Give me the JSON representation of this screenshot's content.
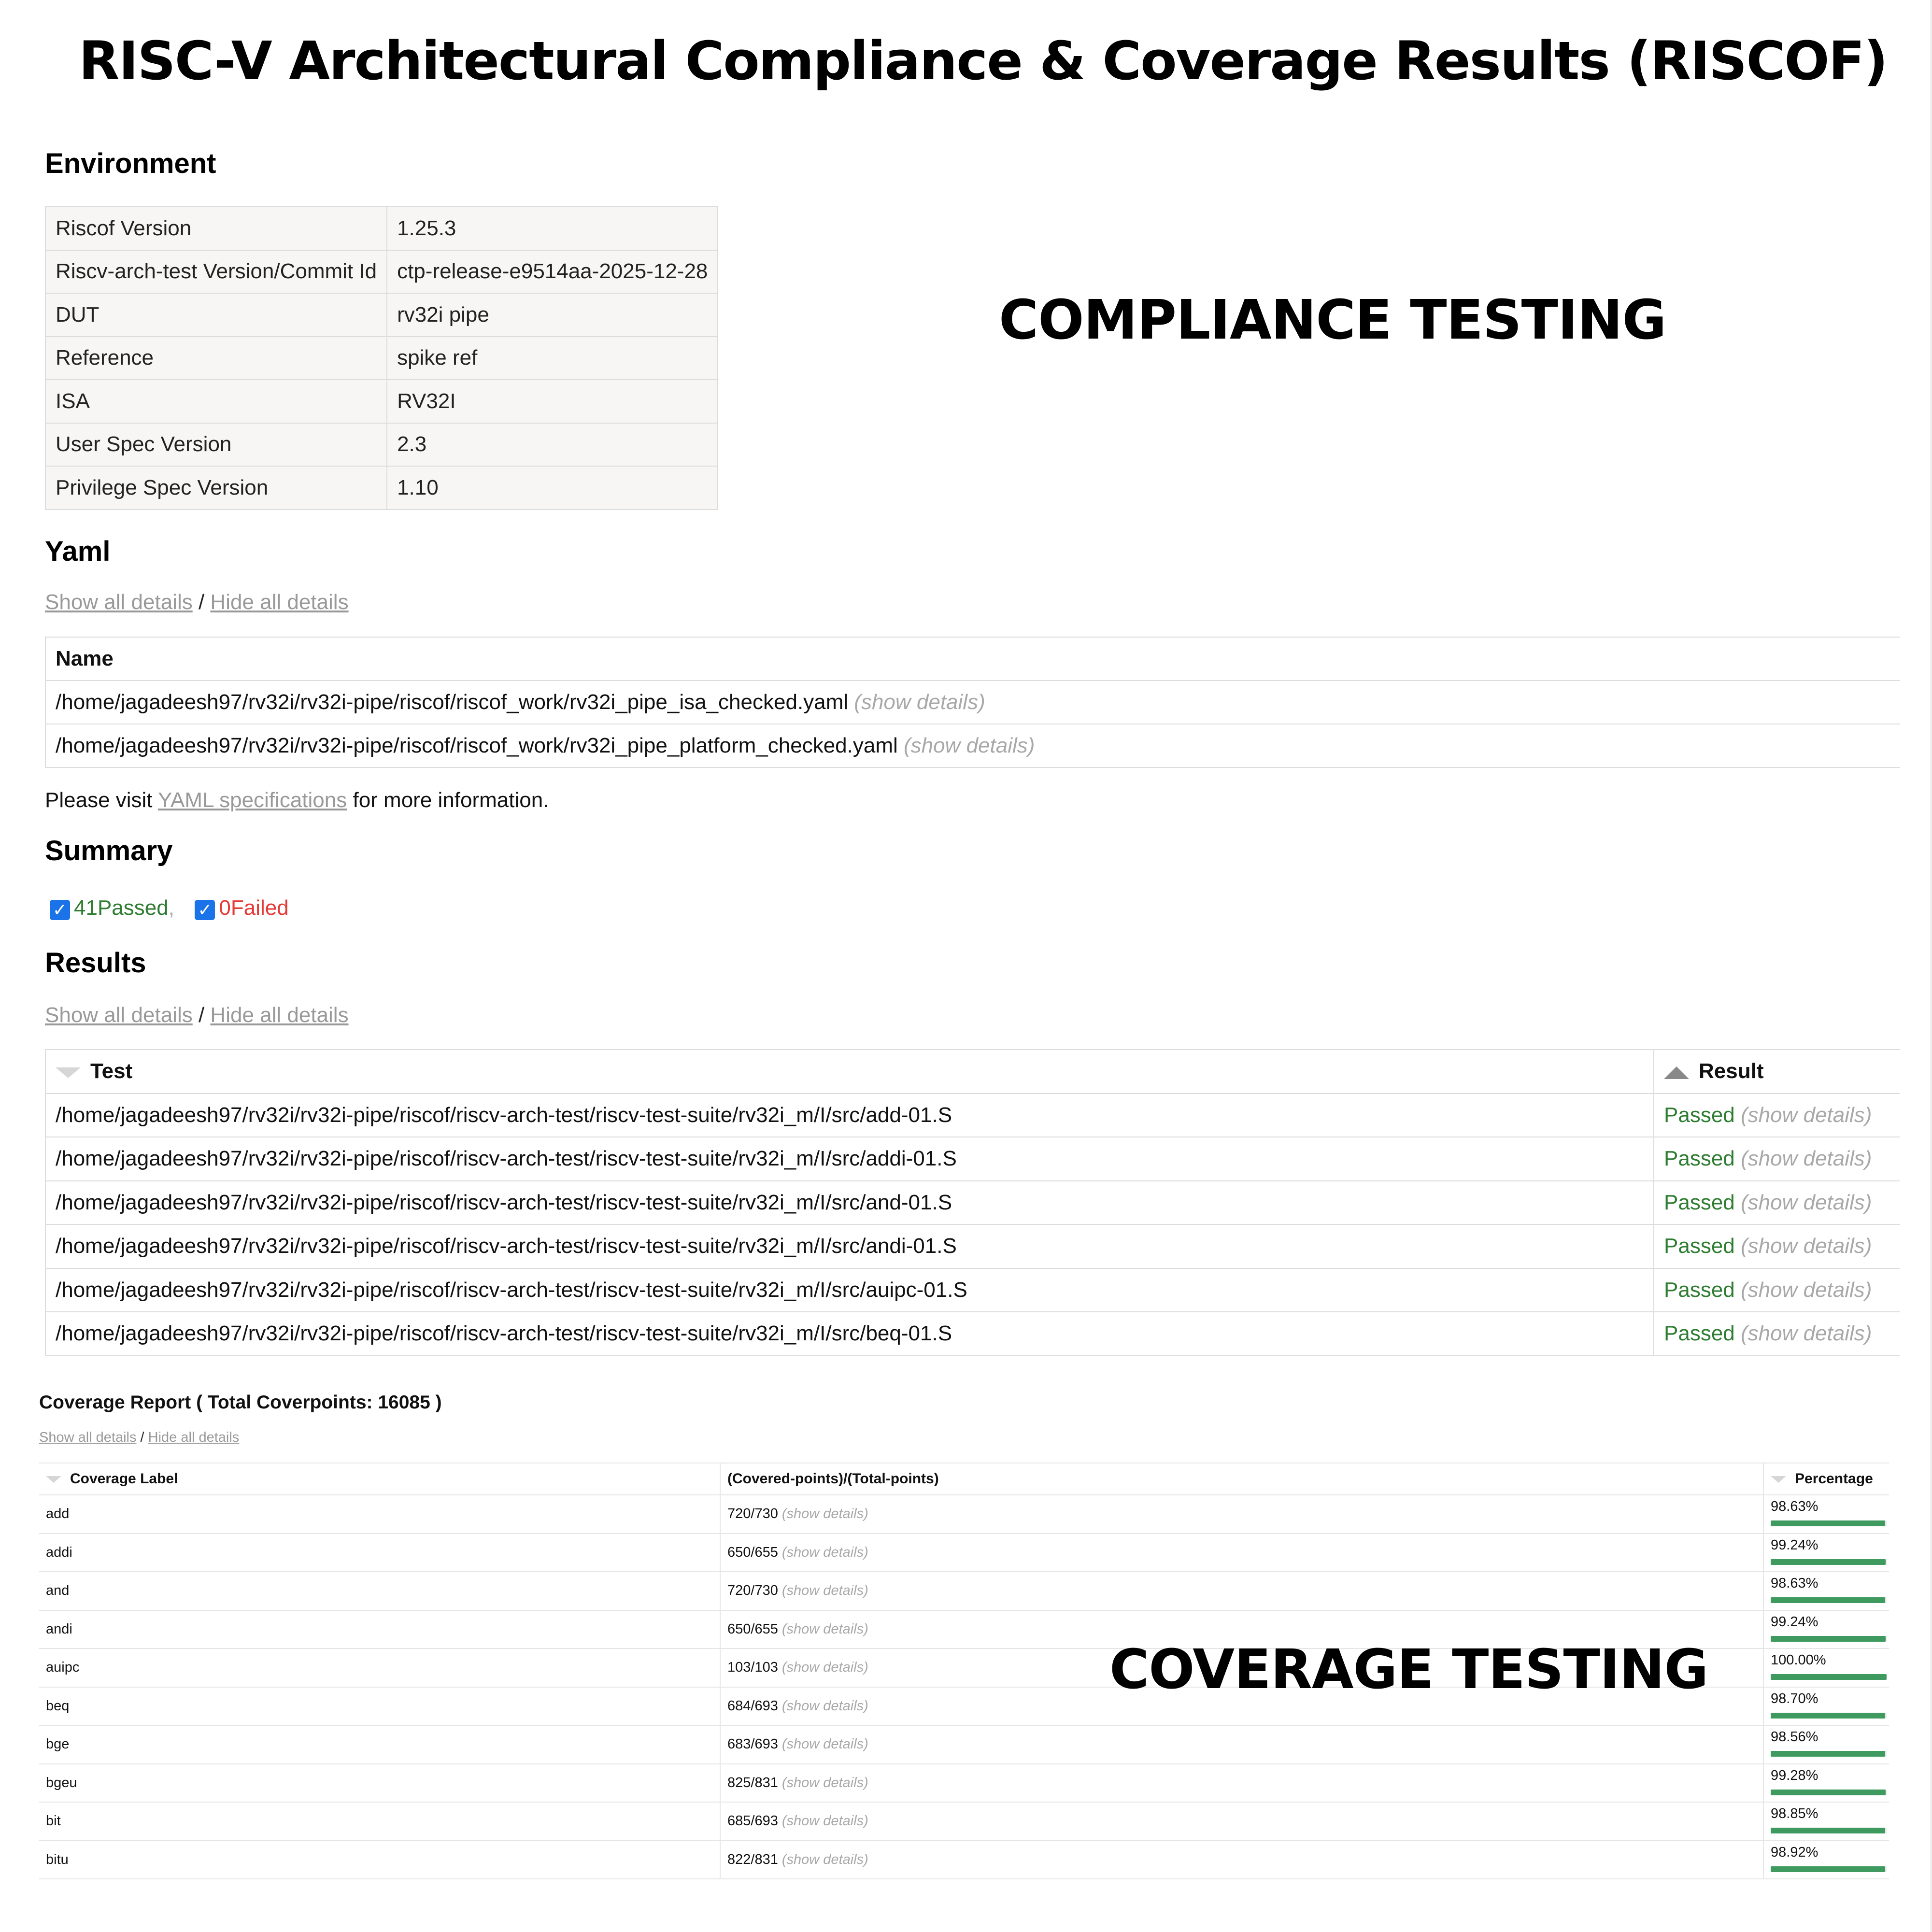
{
  "page_title": "RISC-V Architectural Compliance & Coverage Results (RISCOF)",
  "overlay_compliance": "COMPLIANCE TESTING",
  "overlay_coverage": "COVERAGE TESTING",
  "environment": {
    "heading": "Environment",
    "rows": [
      {
        "key": "Riscof Version",
        "value": "1.25.3"
      },
      {
        "key": "Riscv-arch-test Version/Commit Id",
        "value": "ctp-release-e9514aa-2025-12-28"
      },
      {
        "key": "DUT",
        "value": "rv32i pipe"
      },
      {
        "key": "Reference",
        "value": "spike ref"
      },
      {
        "key": "ISA",
        "value": "RV32I"
      },
      {
        "key": "User Spec Version",
        "value": "2.3"
      },
      {
        "key": "Privilege Spec Version",
        "value": "1.10"
      }
    ]
  },
  "links": {
    "show_all": "Show all details",
    "sep": " / ",
    "hide_all": "Hide all details",
    "show_details": "(show details)"
  },
  "yaml": {
    "heading": "Yaml",
    "column": "Name",
    "rows": [
      "/home/jagadeesh97/rv32i/rv32i-pipe/riscof/riscof_work/rv32i_pipe_isa_checked.yaml",
      "/home/jagadeesh97/rv32i/rv32i-pipe/riscof/riscof_work/rv32i_pipe_platform_checked.yaml"
    ],
    "note_prefix": "Please visit ",
    "note_link": "YAML specifications",
    "note_suffix": " for more information."
  },
  "summary": {
    "heading": "Summary",
    "passed": "41Passed",
    "comma": ",",
    "failed": "0Failed"
  },
  "results": {
    "heading": "Results",
    "col_test": "Test",
    "col_result": "Result",
    "rows": [
      {
        "test": "/home/jagadeesh97/rv32i/rv32i-pipe/riscof/riscv-arch-test/riscv-test-suite/rv32i_m/I/src/add-01.S",
        "result": "Passed"
      },
      {
        "test": "/home/jagadeesh97/rv32i/rv32i-pipe/riscof/riscv-arch-test/riscv-test-suite/rv32i_m/I/src/addi-01.S",
        "result": "Passed"
      },
      {
        "test": "/home/jagadeesh97/rv32i/rv32i-pipe/riscof/riscv-arch-test/riscv-test-suite/rv32i_m/I/src/and-01.S",
        "result": "Passed"
      },
      {
        "test": "/home/jagadeesh97/rv32i/rv32i-pipe/riscof/riscv-arch-test/riscv-test-suite/rv32i_m/I/src/andi-01.S",
        "result": "Passed"
      },
      {
        "test": "/home/jagadeesh97/rv32i/rv32i-pipe/riscof/riscv-arch-test/riscv-test-suite/rv32i_m/I/src/auipc-01.S",
        "result": "Passed"
      },
      {
        "test": "/home/jagadeesh97/rv32i/rv32i-pipe/riscof/riscv-arch-test/riscv-test-suite/rv32i_m/I/src/beq-01.S",
        "result": "Passed"
      }
    ]
  },
  "coverage": {
    "title": "Coverage Report ( Total Coverpoints: 16085 )",
    "col_label": "Coverage Label",
    "col_points": "(Covered-points)/(Total-points)",
    "col_pct": "Percentage",
    "bar_color": "#3e9a5f",
    "rows": [
      {
        "label": "add",
        "points": "720/730",
        "pct": "98.63%",
        "fraction": 0.9863
      },
      {
        "label": "addi",
        "points": "650/655",
        "pct": "99.24%",
        "fraction": 0.9924
      },
      {
        "label": "and",
        "points": "720/730",
        "pct": "98.63%",
        "fraction": 0.9863
      },
      {
        "label": "andi",
        "points": "650/655",
        "pct": "99.24%",
        "fraction": 0.9924
      },
      {
        "label": "auipc",
        "points": "103/103",
        "pct": "100.00%",
        "fraction": 1.0
      },
      {
        "label": "beq",
        "points": "684/693",
        "pct": "98.70%",
        "fraction": 0.987
      },
      {
        "label": "bge",
        "points": "683/693",
        "pct": "98.56%",
        "fraction": 0.9856
      },
      {
        "label": "bgeu",
        "points": "825/831",
        "pct": "99.28%",
        "fraction": 0.9928
      },
      {
        "label": "bit",
        "points": "685/693",
        "pct": "98.85%",
        "fraction": 0.9885
      },
      {
        "label": "bitu",
        "points": "822/831",
        "pct": "98.92%",
        "fraction": 0.9892
      }
    ]
  }
}
